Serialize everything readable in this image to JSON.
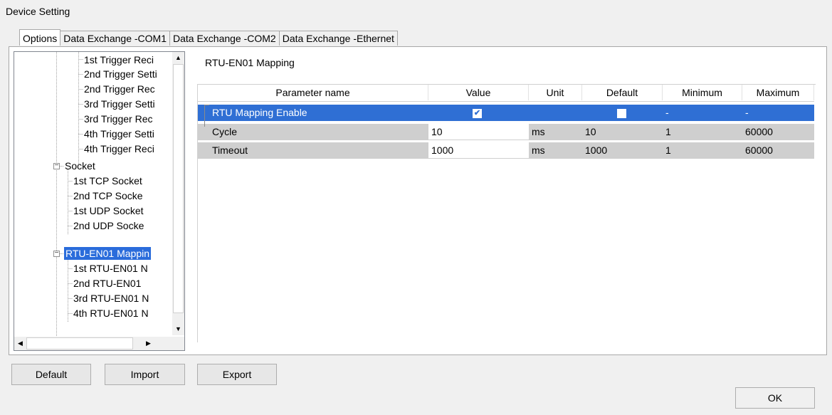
{
  "window": {
    "title": "Device Setting"
  },
  "tabs": [
    {
      "label": "Options",
      "active": true
    },
    {
      "label": "Data Exchange -COM1",
      "active": false
    },
    {
      "label": "Data Exchange -COM2",
      "active": false
    },
    {
      "label": "Data Exchange -Ethernet",
      "active": false
    }
  ],
  "tree": {
    "items": [
      {
        "label": "1st Trigger Reci",
        "level": 2
      },
      {
        "label": "2nd Trigger Setti",
        "level": 2
      },
      {
        "label": "2nd Trigger Rec",
        "level": 2
      },
      {
        "label": "3rd Trigger Setti",
        "level": 2
      },
      {
        "label": "3rd Trigger Rec",
        "level": 2
      },
      {
        "label": "4th Trigger Setti",
        "level": 2
      },
      {
        "label": "4th Trigger Reci",
        "level": 2
      },
      {
        "label": "Socket",
        "level": 1,
        "expander": "minus"
      },
      {
        "label": "1st TCP Socket",
        "level": 2
      },
      {
        "label": "2nd TCP Socke",
        "level": 2
      },
      {
        "label": "1st UDP Socket",
        "level": 2
      },
      {
        "label": "2nd UDP Socke",
        "level": 2
      },
      {
        "label": "RTU-EN01 Mappin",
        "level": 1,
        "expander": "minus",
        "selected": true
      },
      {
        "label": "1st RTU-EN01 N",
        "level": 2
      },
      {
        "label": "2nd RTU-EN01",
        "level": 2
      },
      {
        "label": "3rd RTU-EN01 N",
        "level": 2
      },
      {
        "label": "4th RTU-EN01 N",
        "level": 2
      }
    ]
  },
  "section_title": "RTU-EN01 Mapping",
  "table": {
    "headers": [
      "Parameter name",
      "Value",
      "Unit",
      "Default",
      "Minimum",
      "Maximum"
    ],
    "rows": [
      {
        "name": "RTU Mapping Enable",
        "value_checked": true,
        "unit": "",
        "default_checked": false,
        "minimum": "-",
        "maximum": "-",
        "selected": true
      },
      {
        "name": "Cycle",
        "value": "10",
        "unit": "ms",
        "default": "10",
        "minimum": "1",
        "maximum": "60000"
      },
      {
        "name": "Timeout",
        "value": "1000",
        "unit": "ms",
        "default": "1000",
        "minimum": "1",
        "maximum": "60000"
      }
    ]
  },
  "buttons": {
    "default": "Default",
    "import": "Import",
    "export": "Export",
    "ok": "OK"
  },
  "colors": {
    "selection": "#2f6fd4",
    "tree_selection": "#2a6cdb",
    "readonly_row": "#cfcfcf"
  }
}
